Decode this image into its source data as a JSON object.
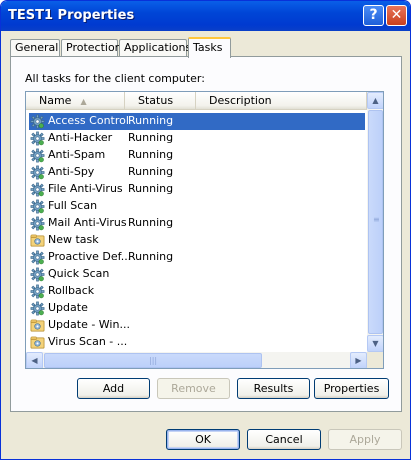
{
  "window": {
    "title": "TEST1 Properties",
    "help_label": "?",
    "close_label": "✕"
  },
  "tabs": [
    {
      "label": "General"
    },
    {
      "label": "Protection"
    },
    {
      "label": "Applications"
    },
    {
      "label": "Tasks",
      "active": true
    }
  ],
  "panel": {
    "label": "All tasks for the client computer:",
    "columns": [
      "Name",
      "Status",
      "Description"
    ],
    "rows": [
      {
        "name": "Access Control",
        "status": "Running",
        "icon": "gear-icon",
        "selected": true
      },
      {
        "name": "Anti-Hacker",
        "status": "Running",
        "icon": "gear-icon"
      },
      {
        "name": "Anti-Spam",
        "status": "Running",
        "icon": "gear-icon"
      },
      {
        "name": "Anti-Spy",
        "status": "Running",
        "icon": "gear-icon"
      },
      {
        "name": "File Anti-Virus",
        "status": "Running",
        "icon": "gear-icon"
      },
      {
        "name": "Full Scan",
        "status": "",
        "icon": "gear-icon"
      },
      {
        "name": "Mail Anti-Virus",
        "status": "Running",
        "icon": "gear-icon"
      },
      {
        "name": "New task",
        "status": "",
        "icon": "task-folder-icon"
      },
      {
        "name": "Proactive Def...",
        "status": "Running",
        "icon": "gear-icon"
      },
      {
        "name": "Quick Scan",
        "status": "",
        "icon": "gear-icon"
      },
      {
        "name": "Rollback",
        "status": "",
        "icon": "gear-icon"
      },
      {
        "name": "Update",
        "status": "",
        "icon": "gear-icon"
      },
      {
        "name": "Update - Win...",
        "status": "",
        "icon": "task-folder-icon"
      },
      {
        "name": "Virus Scan - ...",
        "status": "",
        "icon": "task-folder-icon"
      }
    ],
    "buttons": {
      "add": "Add",
      "remove": "Remove",
      "results": "Results",
      "properties": "Properties"
    }
  },
  "footer": {
    "ok": "OK",
    "cancel": "Cancel",
    "apply": "Apply"
  }
}
